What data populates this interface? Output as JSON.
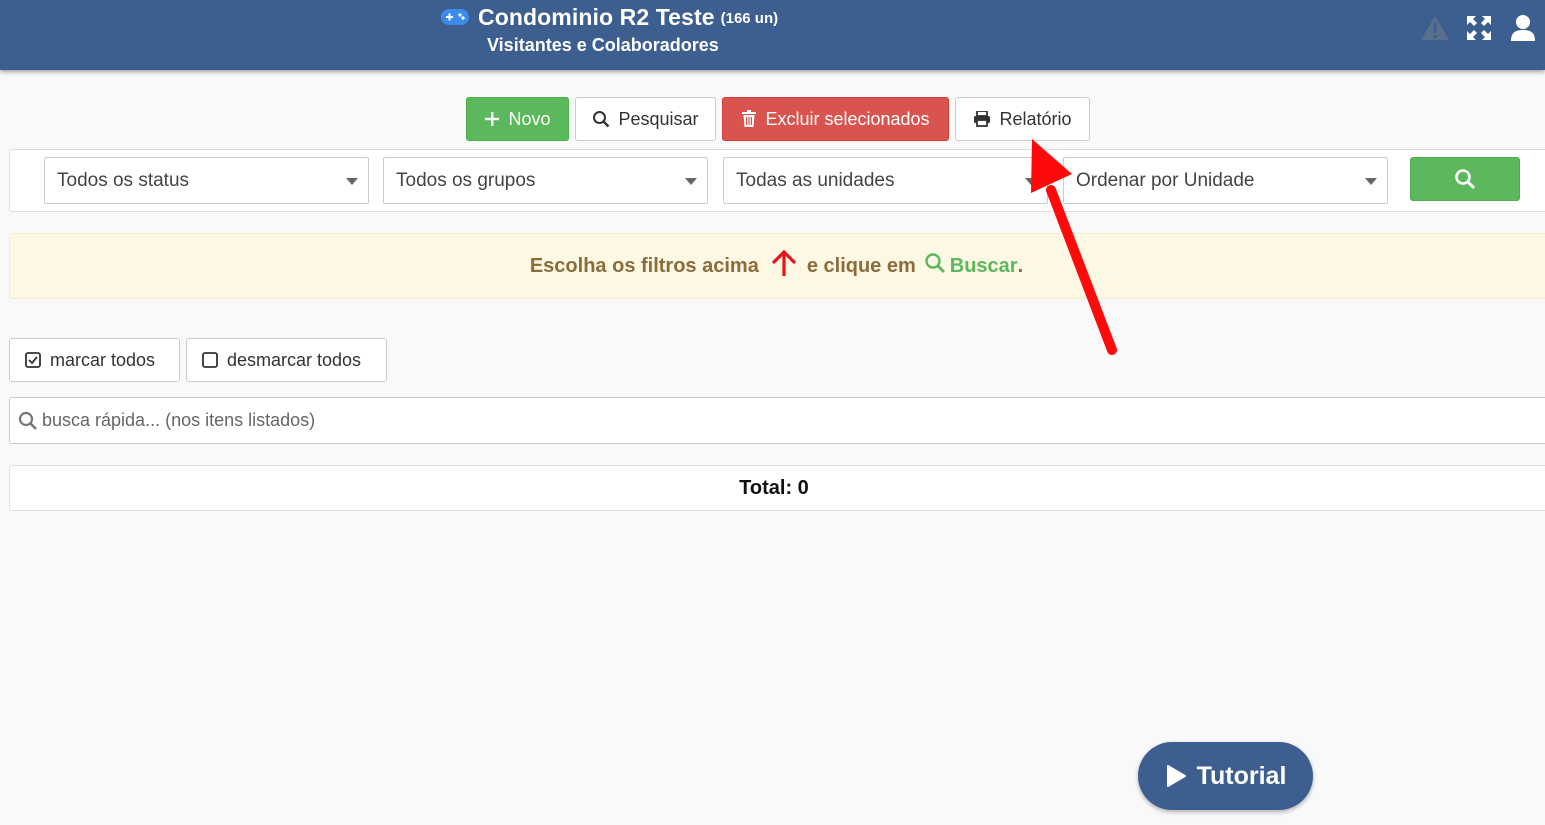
{
  "header": {
    "title": "Condominio R2 Teste",
    "unit_count": "(166 un)",
    "subtitle": "Visitantes e Colaboradores",
    "icons": [
      "gamepad-icon",
      "warning-icon",
      "fullscreen-icon",
      "user-icon"
    ]
  },
  "toolbar": {
    "new_label": "Novo",
    "search_label": "Pesquisar",
    "delete_label": "Excluir selecionados",
    "report_label": "Relatório"
  },
  "filters": {
    "status": "Todos os status",
    "groups": "Todos os grupos",
    "units": "Todas as unidades",
    "order": "Ordenar por Unidade"
  },
  "alert": {
    "text_before": "Escolha os filtros acima",
    "text_middle": "e clique em",
    "buscar": "Buscar",
    "period": "."
  },
  "selection": {
    "mark_all": "marcar todos",
    "unmark_all": "desmarcar todos"
  },
  "quick_search": {
    "placeholder": "busca rápida... (nos itens listados)"
  },
  "total": {
    "label": "Total: 0"
  },
  "tutorial": {
    "label": "Tutorial"
  },
  "colors": {
    "header_bg": "#3d5f8f",
    "success": "#5cb85c",
    "danger": "#d9534f",
    "warning_bg": "#fcf8e3",
    "warning_text": "#8a6d3b",
    "annotation_arrow": "#ff0000"
  }
}
